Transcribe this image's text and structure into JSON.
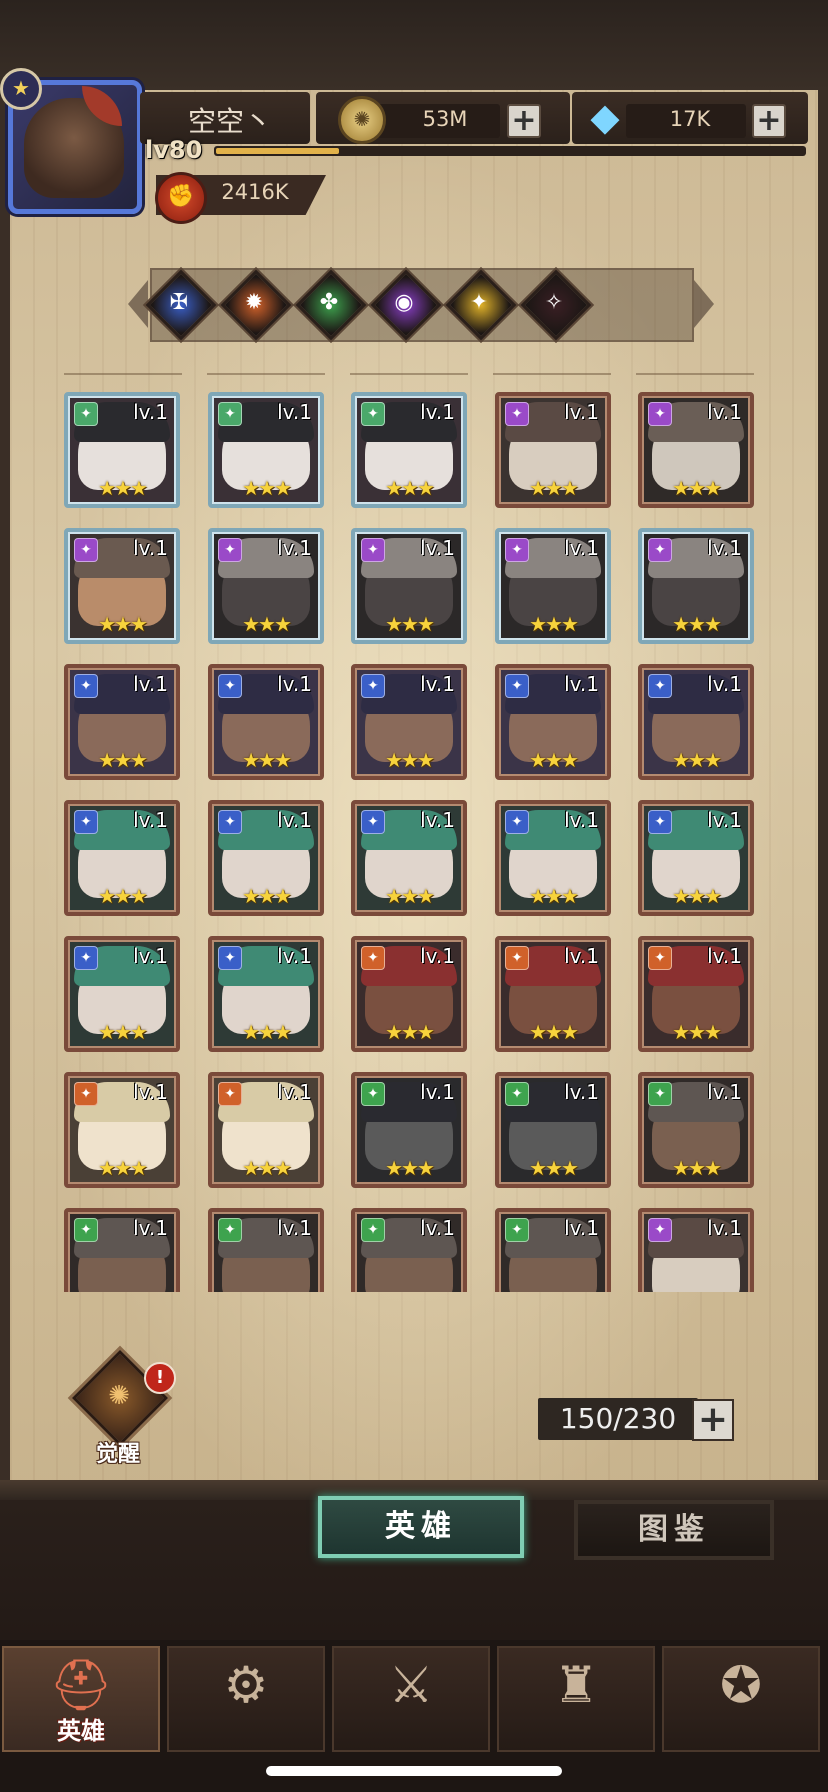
{
  "player": {
    "name": "空空丶",
    "level": "lv80",
    "xp_fraction": 0.21,
    "power": "2416K"
  },
  "resources": {
    "gold": "53M",
    "gems": "17K",
    "add_symbol": "+"
  },
  "factions": [
    {
      "name": "faction-filter-blue",
      "color": "#3a5fc8",
      "symbol": "✠"
    },
    {
      "name": "faction-filter-orange",
      "color": "#d0612a",
      "symbol": "✹"
    },
    {
      "name": "faction-filter-green",
      "color": "#3ea34e",
      "symbol": "✤"
    },
    {
      "name": "faction-filter-purple",
      "color": "#8a3fc8",
      "symbol": "◉"
    },
    {
      "name": "faction-filter-gold",
      "color": "#e0b22a",
      "symbol": "✦"
    },
    {
      "name": "faction-filter-dark",
      "color": "#3a1f24",
      "symbol": "✧"
    }
  ],
  "hero_rows": [
    [
      {
        "lv": "lv.1",
        "stars": "★★★",
        "frame": "blue",
        "badge": "#4aa86a",
        "hero": "vampire"
      },
      {
        "lv": "lv.1",
        "stars": "★★★",
        "frame": "blue",
        "badge": "#4aa86a",
        "hero": "vampire"
      },
      {
        "lv": "lv.1",
        "stars": "★★★",
        "frame": "blue",
        "badge": "#4aa86a",
        "hero": "vampire"
      },
      {
        "lv": "lv.1",
        "stars": "★★★",
        "frame": "brown",
        "badge": "#9a4ac8",
        "hero": "pale"
      },
      {
        "lv": "lv.1",
        "stars": "★★★",
        "frame": "brown",
        "badge": "#9a4ac8",
        "hero": "mummy"
      }
    ],
    [
      {
        "lv": "lv.1",
        "stars": "★★★",
        "frame": "blue",
        "badge": "#9a4ac8",
        "hero": "goggles"
      },
      {
        "lv": "lv.1",
        "stars": "★★★",
        "frame": "blue",
        "badge": "#9a4ac8",
        "hero": "hooded"
      },
      {
        "lv": "lv.1",
        "stars": "★★★",
        "frame": "blue",
        "badge": "#9a4ac8",
        "hero": "hooded"
      },
      {
        "lv": "lv.1",
        "stars": "★★★",
        "frame": "blue",
        "badge": "#9a4ac8",
        "hero": "hooded"
      },
      {
        "lv": "lv.1",
        "stars": "★★★",
        "frame": "blue",
        "badge": "#9a4ac8",
        "hero": "hooded"
      }
    ],
    [
      {
        "lv": "lv.1",
        "stars": "★★★",
        "frame": "brown",
        "badge": "#3a5fc8",
        "hero": "rogue"
      },
      {
        "lv": "lv.1",
        "stars": "★★★",
        "frame": "brown",
        "badge": "#3a5fc8",
        "hero": "rogue"
      },
      {
        "lv": "lv.1",
        "stars": "★★★",
        "frame": "brown",
        "badge": "#3a5fc8",
        "hero": "rogue"
      },
      {
        "lv": "lv.1",
        "stars": "★★★",
        "frame": "brown",
        "badge": "#3a5fc8",
        "hero": "rogue"
      },
      {
        "lv": "lv.1",
        "stars": "★★★",
        "frame": "brown",
        "badge": "#3a5fc8",
        "hero": "rogue"
      }
    ],
    [
      {
        "lv": "lv.1",
        "stars": "★★★",
        "frame": "brown",
        "badge": "#3a5fc8",
        "hero": "greenhair"
      },
      {
        "lv": "lv.1",
        "stars": "★★★",
        "frame": "brown",
        "badge": "#3a5fc8",
        "hero": "greenhair"
      },
      {
        "lv": "lv.1",
        "stars": "★★★",
        "frame": "brown",
        "badge": "#3a5fc8",
        "hero": "greenhair"
      },
      {
        "lv": "lv.1",
        "stars": "★★★",
        "frame": "brown",
        "badge": "#3a5fc8",
        "hero": "greenhair"
      },
      {
        "lv": "lv.1",
        "stars": "★★★",
        "frame": "brown",
        "badge": "#3a5fc8",
        "hero": "greenhair"
      }
    ],
    [
      {
        "lv": "lv.1",
        "stars": "★★★",
        "frame": "brown",
        "badge": "#3a5fc8",
        "hero": "greenhair"
      },
      {
        "lv": "lv.1",
        "stars": "★★★",
        "frame": "brown",
        "badge": "#3a5fc8",
        "hero": "greenhair"
      },
      {
        "lv": "lv.1",
        "stars": "★★★",
        "frame": "brown",
        "badge": "#d0612a",
        "hero": "headband"
      },
      {
        "lv": "lv.1",
        "stars": "★★★",
        "frame": "brown",
        "badge": "#d0612a",
        "hero": "headband"
      },
      {
        "lv": "lv.1",
        "stars": "★★★",
        "frame": "brown",
        "badge": "#d0612a",
        "hero": "headband"
      }
    ],
    [
      {
        "lv": "lv.1",
        "stars": "★★★",
        "frame": "brown",
        "badge": "#d0612a",
        "hero": "blonde"
      },
      {
        "lv": "lv.1",
        "stars": "★★★",
        "frame": "brown",
        "badge": "#d0612a",
        "hero": "blonde"
      },
      {
        "lv": "lv.1",
        "stars": "★★★",
        "frame": "brown",
        "badge": "#3ea34e",
        "hero": "masked"
      },
      {
        "lv": "lv.1",
        "stars": "★★★",
        "frame": "brown",
        "badge": "#3ea34e",
        "hero": "masked"
      },
      {
        "lv": "lv.1",
        "stars": "★★★",
        "frame": "brown",
        "badge": "#3ea34e",
        "hero": "helmet"
      }
    ],
    [
      {
        "lv": "lv.1",
        "stars": "★★★",
        "frame": "brown",
        "badge": "#3ea34e",
        "hero": "helmet"
      },
      {
        "lv": "lv.1",
        "stars": "★★★",
        "frame": "brown",
        "badge": "#3ea34e",
        "hero": "helmet"
      },
      {
        "lv": "lv.1",
        "stars": "★★★",
        "frame": "brown",
        "badge": "#3ea34e",
        "hero": "helmet"
      },
      {
        "lv": "lv.1",
        "stars": "★★★",
        "frame": "brown",
        "badge": "#3ea34e",
        "hero": "helmet"
      },
      {
        "lv": "lv.1",
        "stars": "★★★",
        "frame": "brown",
        "badge": "#9a4ac8",
        "hero": "pale"
      }
    ]
  ],
  "awaken": {
    "label": "觉醒",
    "alert": "!"
  },
  "capacity": {
    "text": "150/230",
    "add_symbol": "+"
  },
  "tabs": {
    "heroes": "英雄",
    "codex": "图鉴"
  },
  "bottom_nav": [
    {
      "name": "nav-heroes",
      "label": "英雄",
      "icon": "helmet-icon",
      "glyph": "⛑",
      "active": true
    },
    {
      "name": "nav-map",
      "label": "",
      "icon": "map-icon",
      "glyph": "⚙",
      "active": false
    },
    {
      "name": "nav-battle",
      "label": "",
      "icon": "crossed-swords-icon",
      "glyph": "⚔",
      "active": false
    },
    {
      "name": "nav-castle",
      "label": "",
      "icon": "castle-icon",
      "glyph": "♜",
      "active": false
    },
    {
      "name": "nav-guild",
      "label": "",
      "icon": "guild-crest-icon",
      "glyph": "✪",
      "active": false
    }
  ]
}
